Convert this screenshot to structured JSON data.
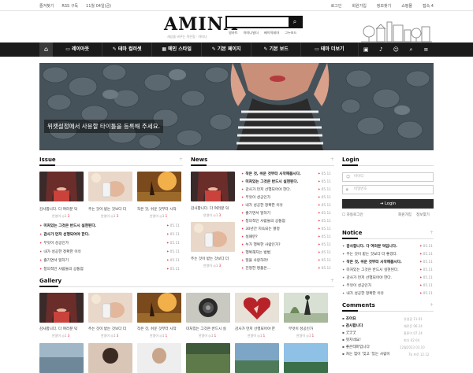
{
  "topbar": {
    "left": [
      "즐겨찾기",
      "RSS 구독",
      "11월 04일(금)"
    ],
    "right": [
      "로그인",
      "회원가입",
      "정보찾기",
      "쇼핑몰",
      "접속 4"
    ]
  },
  "header": {
    "logo": "AMINA",
    "slogan": "새상을 바꾸는 작은힘 · 아미나",
    "search_button_icon": "search-icon",
    "keywords": [
      "영카트",
      "아미나빌더",
      "베이직테마",
      "그누보드"
    ]
  },
  "nav": {
    "home_icon": "home-icon",
    "items": [
      {
        "icon": "monitor-icon",
        "label": "레이아웃"
      },
      {
        "icon": "brush-icon",
        "label": "테마 컬러셋"
      },
      {
        "icon": "grid-icon",
        "label": "메인 스타일"
      },
      {
        "icon": "brush-icon",
        "label": "기본 페이지"
      },
      {
        "icon": "brush-icon",
        "label": "기본 보드"
      },
      {
        "icon": "monitor-icon",
        "label": "테마 더보기"
      }
    ],
    "right_icons": [
      "bag-icon",
      "bell-icon",
      "user-icon",
      "search-icon",
      "menu-icon"
    ]
  },
  "hero": {
    "caption": "위젯설정에서 사용할 타이틀을 등록해 주세요."
  },
  "issue": {
    "title": "Issue",
    "thumbs": [
      {
        "caption": "감사합니다. 다 여러분 덕",
        "author": "안영이",
        "views": "1",
        "points": "3"
      },
      {
        "caption": "주는 것이 받는 것보다 더 ",
        "author": "안영이",
        "views": "1",
        "points": "3"
      },
      {
        "caption": "작은 것, 쉬운 것부터 시작",
        "author": "안영이",
        "views": "1",
        "points": "1"
      }
    ],
    "items": [
      {
        "text": "미처있는 그것은 반드시 실현된다.",
        "bold": true,
        "date": "05.11"
      },
      {
        "text": "감사가 먼저 선행되어야 한다.",
        "bold": true,
        "date": "05.11"
      },
      {
        "text": "무엇이 성공인가",
        "bold": false,
        "date": "05.11"
      },
      {
        "text": "내가 성공한 정확한 이유",
        "bold": false,
        "date": "05.11"
      },
      {
        "text": "즐기면서 일하기",
        "bold": false,
        "date": "05.11"
      },
      {
        "text": "창의적인 사람들의 공통점",
        "bold": false,
        "date": "05.11"
      }
    ]
  },
  "news": {
    "title": "News",
    "thumbs": [
      {
        "caption": "감사합니다. 다 여러분 덕",
        "author": "안영이",
        "views": "1",
        "points": "3"
      },
      {
        "caption": "주는 것이 받는 것보다 더",
        "author": "안영이",
        "views": "1",
        "points": "3"
      }
    ],
    "items": [
      {
        "text": "작은 것, 쉬운 것부터 시작해봅시다.",
        "bold": true,
        "date": "05.11"
      },
      {
        "text": "미처있는 그것은 반드시 실현된다.",
        "bold": true,
        "date": "05.11"
      },
      {
        "text": "감사가 먼저 선행되어야 한다.",
        "bold": false,
        "date": "05.11"
      },
      {
        "text": "무엇이 성공인가",
        "bold": false,
        "date": "05.11"
      },
      {
        "text": "내가 성공한 정확한 이유",
        "bold": false,
        "date": "05.11"
      },
      {
        "text": "즐기면서 일하기",
        "bold": false,
        "date": "05.11"
      },
      {
        "text": "창의적인 사람들의 공통점",
        "bold": false,
        "date": "05.11"
      },
      {
        "text": "30년간 지속되는 열정",
        "bold": false,
        "date": "05.11"
      },
      {
        "text": "실패란?",
        "bold": false,
        "date": "05.11"
      },
      {
        "text": "누가 행복한 사람인가?",
        "bold": false,
        "date": "05.11"
      },
      {
        "text": "행복해지는 방법",
        "bold": false,
        "date": "05.11"
      },
      {
        "text": "일을 사랑하라!",
        "bold": false,
        "date": "05.11"
      },
      {
        "text": "진정한 명품은...",
        "bold": false,
        "date": "05.11"
      }
    ]
  },
  "login": {
    "title": "Login",
    "id_placeholder": "아이디",
    "pw_placeholder": "비밀번호",
    "button": "Login",
    "auto_login": "자동로그인",
    "join": "회원가입",
    "find": "정보찾기"
  },
  "notice": {
    "title": "Notice",
    "items": [
      {
        "text": "감사합니다. 다 여러분 덕입니다.",
        "bold": true,
        "date": "05.11"
      },
      {
        "text": "주는 것이 받는 것보다 더 좋겠다.",
        "bold": false,
        "date": "05.11"
      },
      {
        "text": "작은 것, 쉬운 것부터 시작해봅시다.",
        "bold": true,
        "date": "05.11"
      },
      {
        "text": "미처있는 그것은 반드시 실현된다.",
        "bold": false,
        "date": "05.11"
      },
      {
        "text": "감사가 먼저 선행되어야 한다.",
        "bold": false,
        "date": "05.11"
      },
      {
        "text": "무엇이 성공인가",
        "bold": false,
        "date": "05.11"
      },
      {
        "text": "내가 성공한 정확한 이유",
        "bold": false,
        "date": "05.11"
      }
    ]
  },
  "comments": {
    "title": "Comments",
    "items": [
      {
        "text": "조아요",
        "author": "유영권",
        "date": "11.01"
      },
      {
        "text": "감사합니다",
        "author": "제로운",
        "date": "06.24"
      },
      {
        "text": "굿굿굿",
        "author": "흥론이",
        "date": "07.24"
      },
      {
        "text": "멋지네요!",
        "author": "최다",
        "date": "02.04"
      },
      {
        "text": "좋은테마입니다",
        "author": "12월2023",
        "date": "03.10"
      },
      {
        "text": "자는 힘이 '잊고 '있는 사람이",
        "author": "7b 프로",
        "date": "12.12"
      }
    ]
  },
  "gallery": {
    "title": "Gallery",
    "thumbs": [
      {
        "caption": "감사합니다. 다 여러분 덕",
        "author": "안영이",
        "views": "1",
        "points": "3"
      },
      {
        "caption": "주는 것이 받는 것보다 더",
        "author": "안영이",
        "views": "1",
        "points": "3"
      },
      {
        "caption": "작은 것, 쉬운 것부터 시작",
        "author": "안영이",
        "views": "1",
        "points": "1"
      },
      {
        "caption": "미처있는 그것은 반드시 실",
        "author": "안영이",
        "views": "1",
        "points": "1"
      },
      {
        "caption": "감사가 먼저 선행되어야 한",
        "author": "안영이",
        "views": "1",
        "points": "1"
      },
      {
        "caption": "무엇이 성공인가",
        "author": "안영이",
        "views": "1",
        "points": "1"
      }
    ]
  },
  "colors": {
    "nav_bg": "#1b1b1b",
    "accent_red": "#e22233",
    "text_dark": "#111111"
  }
}
